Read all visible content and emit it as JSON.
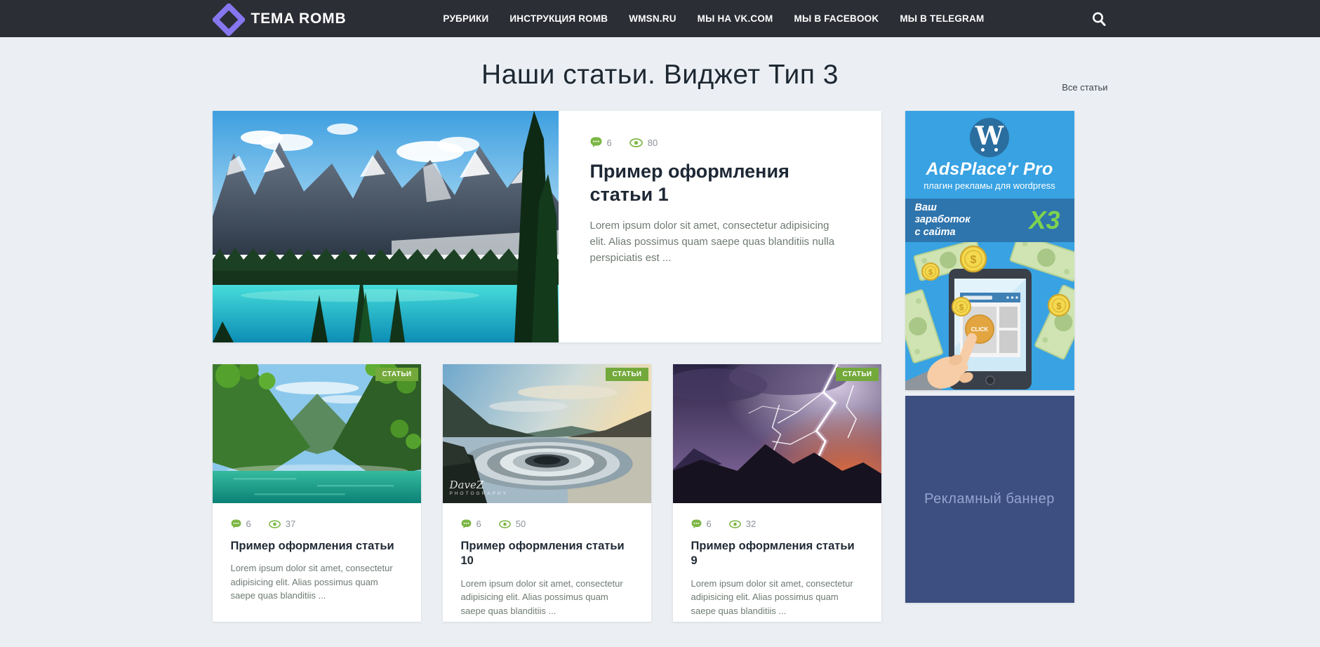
{
  "header": {
    "brand": "TEMA ROMB",
    "nav": [
      "РУБРИКИ",
      "ИНСТРУКЦИЯ ROMB",
      "WMSN.RU",
      "МЫ НА VK.COM",
      "МЫ В FACEBOOK",
      "МЫ В TELEGRAM"
    ],
    "search_icon": "search-icon"
  },
  "page": {
    "title": "Наши статьи. Виджет Тип 3",
    "all_articles": "Все статьи"
  },
  "featured": {
    "comments": "6",
    "views": "80",
    "title": "Пример оформления статьи 1",
    "excerpt": "Lorem ipsum dolor sit amet, consectetur adipisicing elit. Alias possimus quam saepe quas blanditiis nulla perspiciatis est ...",
    "image_alt": "mountain-turquoise-lake-photo"
  },
  "articles": [
    {
      "badge": "СТАТЬИ",
      "comments": "6",
      "views": "37",
      "title": "Пример оформления статьи",
      "excerpt": "Lorem ipsum dolor sit amet, consectetur adipisicing elit. Alias possimus quam saepe quas blanditiis ...",
      "image_alt": "green-forest-lake-photo"
    },
    {
      "badge": "СТАТЬИ",
      "comments": "6",
      "views": "50",
      "title": "Пример оформления статьи 10",
      "excerpt": "Lorem ipsum dolor sit amet, consectetur adipisicing elit. Alias possimus quam saepe quas blanditiis ...",
      "image_alt": "reservoir-spillway-photo",
      "watermark_line1": "DaveZ",
      "watermark_line2": "PHOTOGRAPHY"
    },
    {
      "badge": "СТАТЬИ",
      "comments": "6",
      "views": "32",
      "title": "Пример оформления статьи 9",
      "excerpt": "Lorem ipsum dolor sit amet, consectetur adipisicing elit. Alias possimus quam saepe quas blanditiis ...",
      "image_alt": "lightning-storm-photo"
    }
  ],
  "sidebar": {
    "ad_top": {
      "logo_letter": "W",
      "title": "AdsPlace'r Pro",
      "subtitle": "плагин рекламы для wordpress",
      "slogan": "Ваш\nзаработок\nс сайта",
      "multiplier": "X3",
      "click_label": "CLICK"
    },
    "ad_bottom": {
      "label": "Рекламный баннер"
    }
  },
  "colors": {
    "navbar": "#2c2e35",
    "logo_purple": "#8677f0",
    "accent_green": "#7cb644",
    "badge_green": "#73a93b",
    "ad_blue": "#38a2e2",
    "ad_band_blue": "#2e74ad",
    "ad_multiplier_green": "#7ed34e",
    "banner_navy": "#3d4e80",
    "page_bg": "#ebeff3"
  }
}
